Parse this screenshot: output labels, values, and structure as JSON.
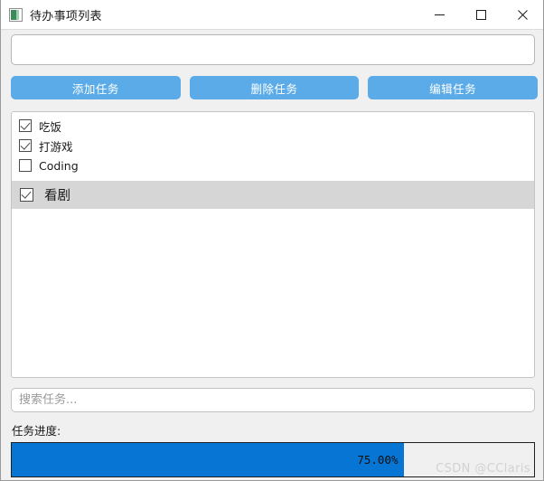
{
  "window": {
    "title": "待办事项列表",
    "icon": "app-window-icon",
    "controls": {
      "minimize": "minimize-icon",
      "maximize": "maximize-icon",
      "close": "close-icon"
    }
  },
  "task_input": {
    "value": "",
    "placeholder": ""
  },
  "buttons": [
    {
      "label": "添加任务",
      "name": "add-task-button"
    },
    {
      "label": "删除任务",
      "name": "delete-task-button"
    },
    {
      "label": "编辑任务",
      "name": "edit-task-button"
    }
  ],
  "task_list": {
    "items": [
      {
        "label": "吃饭",
        "checked": true,
        "selected": false
      },
      {
        "label": "打游戏",
        "checked": true,
        "selected": false
      },
      {
        "label": "Coding",
        "checked": false,
        "selected": false
      },
      {
        "label": "看剧",
        "checked": true,
        "selected": true
      }
    ]
  },
  "search": {
    "value": "",
    "placeholder": "搜索任务..."
  },
  "progress": {
    "label": "任务进度:",
    "percent_text": "75.00%",
    "percent_value": 75
  },
  "watermark": {
    "text": "CSDN @CClaris"
  },
  "colors": {
    "button_blue": "#5aabe8",
    "progress_blue": "#0775d4",
    "selection_gray": "#d6d6d6",
    "window_bg": "#f0f0f0"
  }
}
